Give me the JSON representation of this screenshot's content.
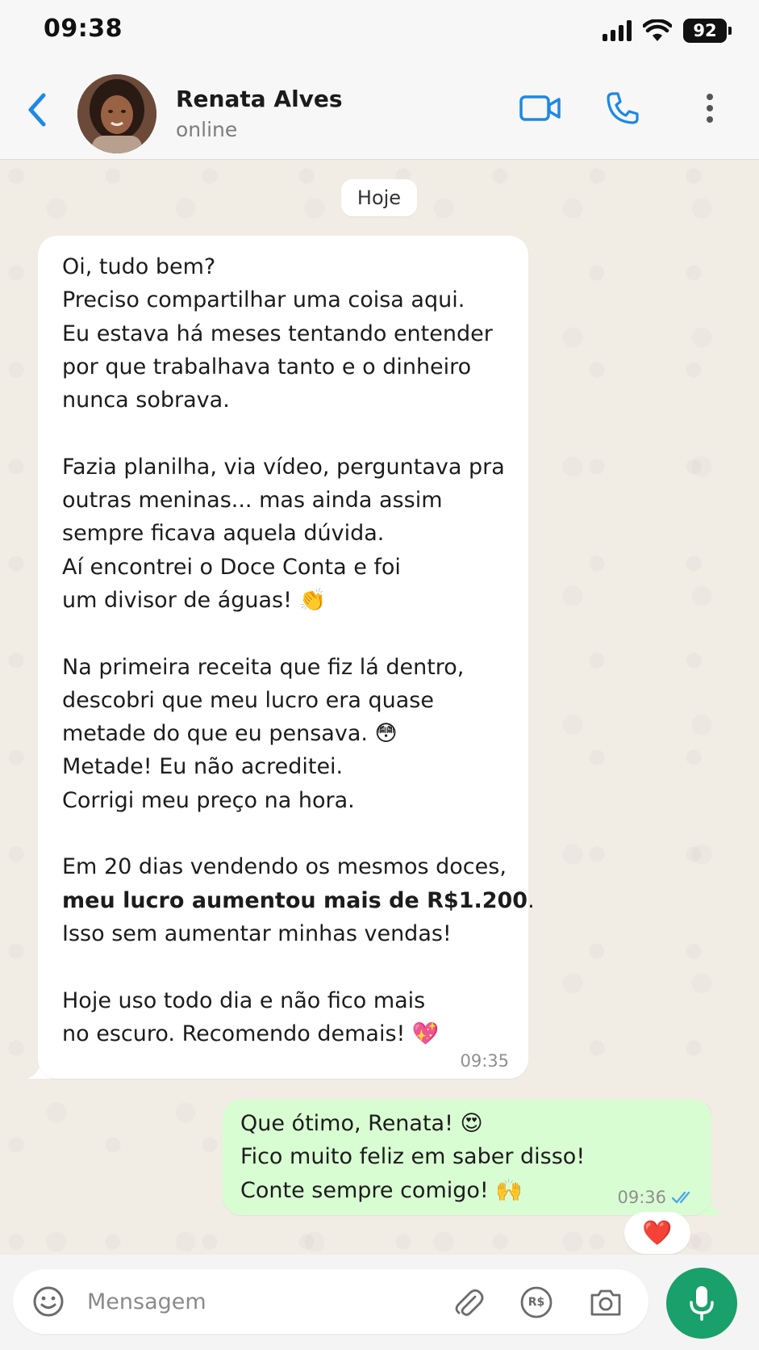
{
  "status_bar": {
    "time": "09:38",
    "battery": "92",
    "icons": [
      "signal-icon",
      "wifi-icon",
      "battery-icon"
    ]
  },
  "header": {
    "contact_name": "Renata Alves",
    "contact_status": "online",
    "icons": [
      "back-arrow-icon",
      "avatar-photo",
      "video-camera-icon",
      "phone-icon",
      "more-vertical-icon"
    ],
    "accent_color": "#1e88e5"
  },
  "chat": {
    "date_label": "Hoje",
    "incoming": {
      "paragraphs": [
        [
          "Oi, tudo bem?",
          "Preciso compartilhar uma coisa aqui.",
          "Eu estava há meses tentando entender",
          "por que trabalhava tanto e o dinheiro",
          "nunca sobrava."
        ],
        [
          "Fazia planilha, via vídeo, perguntava pra",
          "outras meninas... mas ainda assim",
          "sempre ficava aquela dúvida.",
          "Aí encontrei o Doce Conta e foi",
          "um divisor de águas! 👏"
        ],
        [
          "Na primeira receita que fiz lá dentro,",
          "descobri que meu lucro era quase",
          "metade do que eu pensava. 😳",
          "Metade! Eu não acreditei.",
          "Corrigi meu preço na hora."
        ],
        {
          "line1": "Em 20 dias vendendo os mesmos doces,",
          "line2_bold": "meu lucro aumentou mais de R$1.200",
          "line2_end": ".",
          "line3": "Isso sem aumentar minhas vendas!"
        },
        [
          "Hoje uso todo dia e não fico mais",
          "no escuro. Recomendo demais! 💖"
        ]
      ],
      "time": "09:35"
    },
    "outgoing": {
      "lines": [
        "Que ótimo, Renata! 😍",
        "Fico muito feliz em saber disso!",
        "Conte sempre comigo! 🙌"
      ],
      "time": "09:36",
      "status_icon": "double-check-icon",
      "bubble_color": "#d9fdd3"
    },
    "reaction": "❤️"
  },
  "input_bar": {
    "placeholder": "Mensagem",
    "icons": [
      "emoji-icon",
      "attachment-icon",
      "payment-icon",
      "camera-icon",
      "microphone-icon"
    ],
    "pay_icon_label": "R$",
    "mic_color": "#1aa06a"
  }
}
